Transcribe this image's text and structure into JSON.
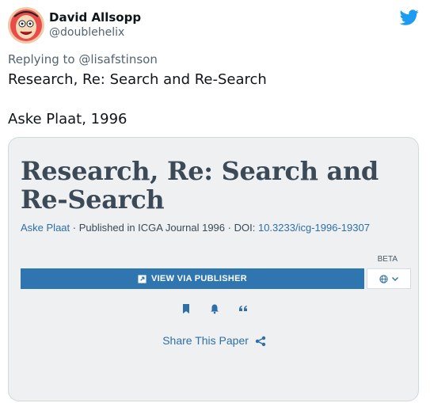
{
  "user": {
    "name": "David Allsopp",
    "handle": "@doublehelix"
  },
  "reply": {
    "prefix": "Replying to",
    "mention": "@lisafstinson"
  },
  "tweet": {
    "lines": [
      "Research, Re: Search and Re-Search",
      "Aske Plaat, 1996"
    ]
  },
  "card": {
    "title": "Research, Re: Search and Re-Search",
    "author": "Aske Plaat",
    "published": "Published in ICGA Journal 1996",
    "doi_label": "DOI:",
    "doi": "10.3233/icg-1996-19307",
    "beta": "BETA",
    "view_button": "VIEW VIA PUBLISHER",
    "share": "Share This Paper"
  },
  "colors": {
    "twitter_blue": "#1d9bf0",
    "button_blue": "#2f76b0",
    "link_blue": "#2f6fa8"
  }
}
